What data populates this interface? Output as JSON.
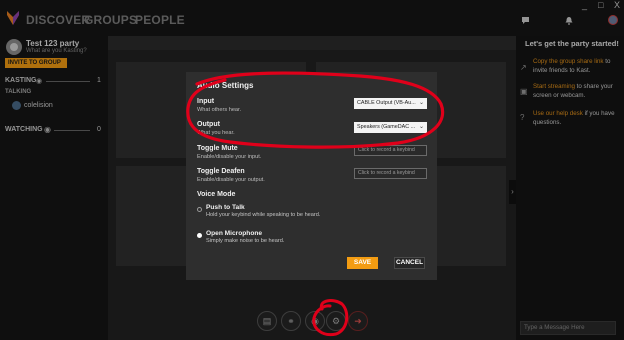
{
  "nav": {
    "items": [
      "DISCOVER",
      "GROUPS",
      "PEOPLE"
    ],
    "window_controls": [
      "_",
      "□",
      "X"
    ]
  },
  "party": {
    "name": "Test 123 party",
    "subtitle": "What are you Kasting?",
    "invite_label": "INVITE TO GROUP"
  },
  "sidebar": {
    "kasting_label": "KASTING",
    "kasting_count": "1",
    "talking_label": "TALKING",
    "talking_user": "colelision",
    "watching_label": "WATCHING",
    "watching_count": "0"
  },
  "right_panel": {
    "title": "Let's get the party started!",
    "tips": [
      {
        "link": "Copy the group share link",
        "text": " to invite friends to Kast."
      },
      {
        "link": "Start streaming",
        "text": " to share your screen or webcam."
      },
      {
        "link": "Use our help desk",
        "text": " if you have questions."
      }
    ],
    "message_placeholder": "Type a Message Here"
  },
  "modal": {
    "title": "Audio Settings",
    "input_label": "Input",
    "input_sub": "What others hear.",
    "input_value": "CABLE Output (VB-Au...",
    "output_label": "Output",
    "output_sub": "What you hear.",
    "output_value": "Speakers (GameDAC ...",
    "toggle_mute_label": "Toggle Mute",
    "toggle_mute_sub": "Enable/disable your input.",
    "toggle_deafen_label": "Toggle Deafen",
    "toggle_deafen_sub": "Enable/disable your output.",
    "keybind_placeholder": "Click to record a keybind",
    "voice_mode_label": "Voice Mode",
    "push_to_talk_label": "Push to Talk",
    "push_to_talk_sub": "Hold your keybind while speaking to be heard.",
    "open_mic_label": "Open Microphone",
    "open_mic_sub": "Simply make noise to be heard.",
    "save_label": "SAVE",
    "cancel_label": "CANCEL"
  },
  "colors": {
    "accent": "#f39c12",
    "annotation": "#e0001a"
  },
  "icons": [
    "kast-logo-icon",
    "chat-icon",
    "bell-icon",
    "user-avatar-icon",
    "controller-icon",
    "eye-icon",
    "share-icon",
    "stream-icon",
    "help-icon",
    "screen-off-icon",
    "mic-off-icon",
    "headphones-icon",
    "gear-icon",
    "leave-icon",
    "chevron-right-icon"
  ]
}
